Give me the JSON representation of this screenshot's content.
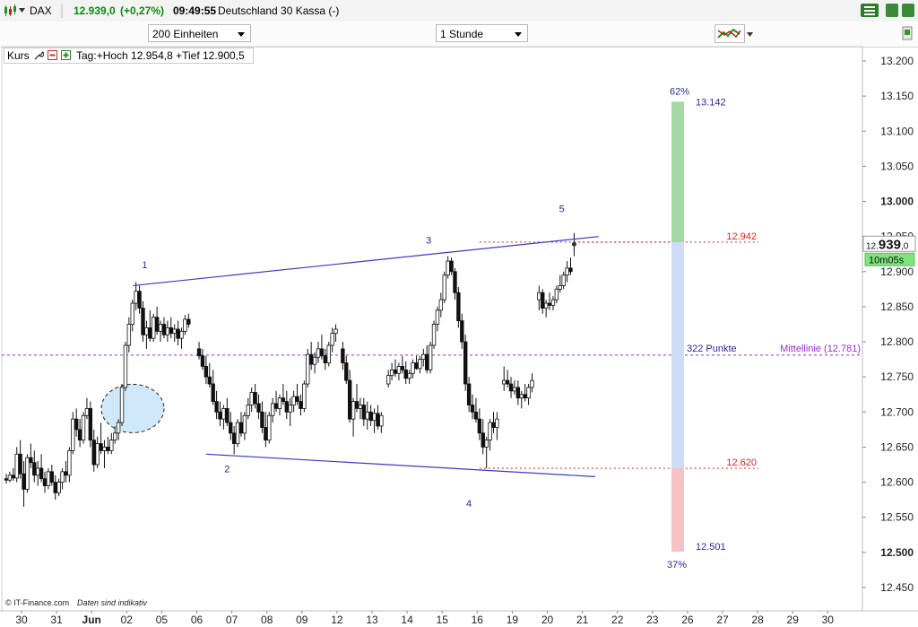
{
  "topbar": {
    "symbol": "DAX",
    "last": "12.939,0",
    "change": "(+0,27%)",
    "time": "09:49:55",
    "instrument": "Deutschland 30 Kassa (-)"
  },
  "toolbar": {
    "units_select": "200 Einheiten",
    "interval_select": "1 Stunde"
  },
  "legend": {
    "label": "Kurs",
    "day_range": "Tag:+Hoch 12.954,8 +Tief 12.900,5"
  },
  "footer": {
    "copyright": "© IT-Finance.com",
    "note": "Daten sind indikativ"
  },
  "colors": {
    "accent_green": "#0a8a0a",
    "trendline": "#3a3ac8",
    "midline": "#9a2fd0",
    "level_red": "#e02020"
  },
  "icons": [
    "wrench-icon",
    "minus-box-icon",
    "plus-box-icon",
    "menu-icon",
    "chart-type-icon"
  ],
  "chart_data": {
    "type": "candlestick",
    "y_ticks": [
      "13.200",
      "13.150",
      "13.100",
      "13.050",
      "13.000",
      "12.950",
      "12.900",
      "12.850",
      "12.800",
      "12.750",
      "12.700",
      "12.650",
      "12.600",
      "12.550",
      "12.500",
      "12.450"
    ],
    "ylim": [
      12430,
      13220
    ],
    "x_tick_labels": [
      "30",
      "31",
      "Jun",
      "02",
      "05",
      "06",
      "07",
      "08",
      "09",
      "12",
      "13",
      "14",
      "15",
      "16",
      "19",
      "20",
      "21",
      "22",
      "23",
      "26",
      "27",
      "28",
      "29",
      "30"
    ],
    "price_box": {
      "value_big": "12.939",
      "value_small": ",0",
      "countdown": "10m05s"
    },
    "wave_labels": [
      "1",
      "2",
      "3",
      "4",
      "5"
    ],
    "resistance_line": {
      "from": [
        0.88,
        12880
      ],
      "to": [
        16.9,
        12950
      ]
    },
    "support_line": {
      "from": [
        5.7,
        12640
      ],
      "to": [
        16.8,
        12608
      ]
    },
    "midline": {
      "value": 12781,
      "label": "Mittellinie (12.781)"
    },
    "levels": [
      {
        "value": 12942,
        "label": "12.942"
      },
      {
        "value": 12620,
        "label": "12.620"
      }
    ],
    "range_bar": {
      "top_pct": "62%",
      "bottom_pct": "37%",
      "top_value": 13142,
      "top_label": "13.142",
      "bottom_value": 12501,
      "bottom_label": "12.501",
      "span_label": "322 Punkte"
    },
    "candles": [
      [
        0.0,
        12605,
        12612,
        12598,
        12603
      ],
      [
        0.1,
        12603,
        12615,
        12600,
        12610
      ],
      [
        0.2,
        12610,
        12620,
        12602,
        12606
      ],
      [
        0.3,
        12606,
        12650,
        12600,
        12640
      ],
      [
        0.4,
        12640,
        12660,
        12605,
        12612
      ],
      [
        0.5,
        12612,
        12630,
        12565,
        12590
      ],
      [
        0.6,
        12590,
        12640,
        12585,
        12635
      ],
      [
        0.7,
        12635,
        12655,
        12620,
        12628
      ],
      [
        0.8,
        12628,
        12645,
        12600,
        12610
      ],
      [
        0.9,
        12610,
        12630,
        12595,
        12620
      ],
      [
        1.0,
        12620,
        12640,
        12600,
        12605
      ],
      [
        1.1,
        12605,
        12615,
        12585,
        12595
      ],
      [
        1.2,
        12595,
        12620,
        12590,
        12615
      ],
      [
        1.3,
        12615,
        12625,
        12595,
        12600
      ],
      [
        1.4,
        12600,
        12610,
        12575,
        12585
      ],
      [
        1.5,
        12585,
        12605,
        12580,
        12600
      ],
      [
        1.6,
        12600,
        12620,
        12590,
        12615
      ],
      [
        1.7,
        12615,
        12630,
        12600,
        12610
      ],
      [
        1.8,
        12610,
        12650,
        12600,
        12645
      ],
      [
        1.9,
        12645,
        12700,
        12640,
        12690
      ],
      [
        2.0,
        12690,
        12705,
        12665,
        12675
      ],
      [
        2.1,
        12675,
        12690,
        12650,
        12660
      ],
      [
        2.2,
        12660,
        12700,
        12655,
        12695
      ],
      [
        2.3,
        12695,
        12720,
        12690,
        12705
      ],
      [
        2.4,
        12705,
        12715,
        12650,
        12660
      ],
      [
        2.5,
        12660,
        12675,
        12615,
        12625
      ],
      [
        2.6,
        12625,
        12665,
        12620,
        12655
      ],
      [
        2.7,
        12655,
        12685,
        12640,
        12645
      ],
      [
        2.8,
        12645,
        12660,
        12620,
        12650
      ],
      [
        2.9,
        12650,
        12665,
        12640,
        12645
      ],
      [
        3.0,
        12645,
        12670,
        12640,
        12660
      ],
      [
        3.1,
        12660,
        12680,
        12655,
        12670
      ],
      [
        3.2,
        12670,
        12690,
        12660,
        12685
      ],
      [
        3.3,
        12685,
        12740,
        12680,
        12735
      ],
      [
        3.4,
        12735,
        12800,
        12730,
        12795
      ],
      [
        3.5,
        12795,
        12835,
        12785,
        12825
      ],
      [
        3.6,
        12825,
        12860,
        12815,
        12855
      ],
      [
        3.7,
        12855,
        12885,
        12845,
        12872
      ],
      [
        3.8,
        12872,
        12880,
        12840,
        12848
      ],
      [
        3.9,
        12848,
        12858,
        12800,
        12810
      ],
      [
        4.0,
        12810,
        12830,
        12790,
        12820
      ],
      [
        4.1,
        12820,
        12845,
        12800,
        12805
      ],
      [
        4.2,
        12805,
        12840,
        12800,
        12835
      ],
      [
        4.3,
        12835,
        12850,
        12810,
        12815
      ],
      [
        4.4,
        12815,
        12830,
        12800,
        12825
      ],
      [
        4.5,
        12825,
        12835,
        12805,
        12810
      ],
      [
        4.6,
        12810,
        12830,
        12800,
        12820
      ],
      [
        4.7,
        12820,
        12835,
        12805,
        12812
      ],
      [
        4.8,
        12812,
        12825,
        12800,
        12818
      ],
      [
        4.9,
        12818,
        12830,
        12795,
        12805
      ],
      [
        5.0,
        12805,
        12820,
        12790,
        12815
      ],
      [
        5.1,
        12815,
        12838,
        12810,
        12832
      ],
      [
        5.2,
        12832,
        12840,
        12820,
        12825
      ],
      [
        5.5,
        12790,
        12800,
        12775,
        12780
      ],
      [
        5.6,
        12780,
        12790,
        12760,
        12765
      ],
      [
        5.7,
        12765,
        12780,
        12740,
        12750
      ],
      [
        5.8,
        12750,
        12770,
        12735,
        12740
      ],
      [
        5.9,
        12740,
        12760,
        12710,
        12715
      ],
      [
        6.0,
        12715,
        12730,
        12690,
        12700
      ],
      [
        6.1,
        12700,
        12715,
        12680,
        12690
      ],
      [
        6.2,
        12690,
        12710,
        12675,
        12705
      ],
      [
        6.3,
        12705,
        12720,
        12680,
        12685
      ],
      [
        6.4,
        12685,
        12700,
        12660,
        12670
      ],
      [
        6.5,
        12670,
        12680,
        12640,
        12655
      ],
      [
        6.6,
        12655,
        12690,
        12650,
        12685
      ],
      [
        6.7,
        12685,
        12700,
        12665,
        12670
      ],
      [
        6.8,
        12670,
        12700,
        12660,
        12695
      ],
      [
        6.9,
        12695,
        12720,
        12690,
        12710
      ],
      [
        7.0,
        12710,
        12735,
        12700,
        12728
      ],
      [
        7.1,
        12728,
        12740,
        12705,
        12712
      ],
      [
        7.2,
        12712,
        12725,
        12690,
        12700
      ],
      [
        7.3,
        12700,
        12715,
        12670,
        12678
      ],
      [
        7.4,
        12678,
        12700,
        12650,
        12660
      ],
      [
        7.5,
        12660,
        12700,
        12655,
        12695
      ],
      [
        7.6,
        12695,
        12720,
        12685,
        12712
      ],
      [
        7.7,
        12712,
        12730,
        12700,
        12705
      ],
      [
        7.8,
        12705,
        12725,
        12695,
        12720
      ],
      [
        7.9,
        12720,
        12740,
        12710,
        12715
      ],
      [
        8.0,
        12715,
        12730,
        12690,
        12700
      ],
      [
        8.1,
        12700,
        12720,
        12680,
        12710
      ],
      [
        8.2,
        12710,
        12730,
        12700,
        12722
      ],
      [
        8.3,
        12722,
        12740,
        12710,
        12715
      ],
      [
        8.4,
        12715,
        12725,
        12695,
        12705
      ],
      [
        8.5,
        12705,
        12745,
        12700,
        12740
      ],
      [
        8.6,
        12740,
        12790,
        12735,
        12782
      ],
      [
        8.7,
        12782,
        12800,
        12760,
        12768
      ],
      [
        8.8,
        12768,
        12785,
        12755,
        12778
      ],
      [
        8.9,
        12778,
        12800,
        12770,
        12790
      ],
      [
        9.0,
        12790,
        12810,
        12775,
        12780
      ],
      [
        9.1,
        12780,
        12790,
        12760,
        12770
      ],
      [
        9.2,
        12770,
        12800,
        12765,
        12795
      ],
      [
        9.3,
        12795,
        12820,
        12785,
        12812
      ],
      [
        9.4,
        12812,
        12825,
        12800,
        12818
      ],
      [
        9.6,
        12790,
        12800,
        12760,
        12770
      ],
      [
        9.7,
        12770,
        12780,
        12740,
        12745
      ],
      [
        9.8,
        12745,
        12760,
        12685,
        12690
      ],
      [
        9.9,
        12690,
        12720,
        12665,
        12715
      ],
      [
        10.0,
        12715,
        12740,
        12700,
        12705
      ],
      [
        10.1,
        12705,
        12720,
        12690,
        12710
      ],
      [
        10.2,
        12710,
        12720,
        12680,
        12690
      ],
      [
        10.3,
        12690,
        12715,
        12675,
        12700
      ],
      [
        10.4,
        12700,
        12710,
        12680,
        12688
      ],
      [
        10.5,
        12688,
        12705,
        12670,
        12698
      ],
      [
        10.6,
        12698,
        12710,
        12675,
        12680
      ],
      [
        10.7,
        12680,
        12700,
        12670,
        12695
      ],
      [
        10.9,
        12740,
        12760,
        12735,
        12752
      ],
      [
        11.0,
        12752,
        12770,
        12745,
        12760
      ],
      [
        11.1,
        12760,
        12775,
        12750,
        12755
      ],
      [
        11.2,
        12755,
        12770,
        12745,
        12765
      ],
      [
        11.3,
        12765,
        12780,
        12755,
        12760
      ],
      [
        11.4,
        12760,
        12772,
        12740,
        12748
      ],
      [
        11.5,
        12748,
        12760,
        12740,
        12755
      ],
      [
        11.6,
        12755,
        12775,
        12748,
        12770
      ],
      [
        11.7,
        12770,
        12780,
        12760,
        12762
      ],
      [
        11.8,
        12762,
        12780,
        12755,
        12775
      ],
      [
        11.9,
        12775,
        12790,
        12765,
        12782
      ],
      [
        12.0,
        12782,
        12795,
        12755,
        12760
      ],
      [
        12.1,
        12760,
        12800,
        12755,
        12795
      ],
      [
        12.2,
        12795,
        12830,
        12790,
        12825
      ],
      [
        12.3,
        12825,
        12850,
        12815,
        12845
      ],
      [
        12.4,
        12845,
        12870,
        12835,
        12860
      ],
      [
        12.5,
        12860,
        12900,
        12855,
        12895
      ],
      [
        12.6,
        12895,
        12922,
        12890,
        12915
      ],
      [
        12.7,
        12915,
        12920,
        12895,
        12900
      ],
      [
        12.8,
        12900,
        12905,
        12860,
        12870
      ],
      [
        12.9,
        12870,
        12878,
        12820,
        12830
      ],
      [
        13.0,
        12830,
        12840,
        12790,
        12800
      ],
      [
        13.1,
        12800,
        12810,
        12730,
        12740
      ],
      [
        13.2,
        12740,
        12750,
        12700,
        12710
      ],
      [
        13.3,
        12710,
        12725,
        12690,
        12700
      ],
      [
        13.4,
        12700,
        12720,
        12685,
        12690
      ],
      [
        13.5,
        12690,
        12705,
        12660,
        12670
      ],
      [
        13.6,
        12670,
        12690,
        12640,
        12650
      ],
      [
        13.7,
        12650,
        12665,
        12620,
        12660
      ],
      [
        13.8,
        12660,
        12690,
        12645,
        12685
      ],
      [
        13.9,
        12685,
        12700,
        12670,
        12678
      ],
      [
        14.0,
        12678,
        12700,
        12660,
        12690
      ],
      [
        14.2,
        12740,
        12765,
        12730,
        12745
      ],
      [
        14.3,
        12745,
        12760,
        12735,
        12740
      ],
      [
        14.4,
        12740,
        12750,
        12720,
        12730
      ],
      [
        14.5,
        12730,
        12745,
        12725,
        12735
      ],
      [
        14.6,
        12735,
        12745,
        12710,
        12720
      ],
      [
        14.7,
        12720,
        12730,
        12705,
        12725
      ],
      [
        14.8,
        12725,
        12740,
        12715,
        12720
      ],
      [
        14.9,
        12720,
        12740,
        12710,
        12735
      ],
      [
        15.0,
        12735,
        12755,
        12728,
        12745
      ],
      [
        15.2,
        12860,
        12880,
        12845,
        12870
      ],
      [
        15.3,
        12870,
        12875,
        12840,
        12848
      ],
      [
        15.4,
        12848,
        12860,
        12835,
        12855
      ],
      [
        15.5,
        12855,
        12870,
        12845,
        12852
      ],
      [
        15.6,
        12852,
        12865,
        12845,
        12860
      ],
      [
        15.7,
        12860,
        12880,
        12855,
        12875
      ],
      [
        15.8,
        12875,
        12895,
        12870,
        12880
      ],
      [
        15.9,
        12880,
        12900,
        12875,
        12895
      ],
      [
        16.0,
        12895,
        12915,
        12885,
        12905
      ],
      [
        16.1,
        12905,
        12920,
        12895,
        12900
      ],
      [
        16.2,
        12938,
        12955,
        12922,
        12939
      ]
    ]
  }
}
